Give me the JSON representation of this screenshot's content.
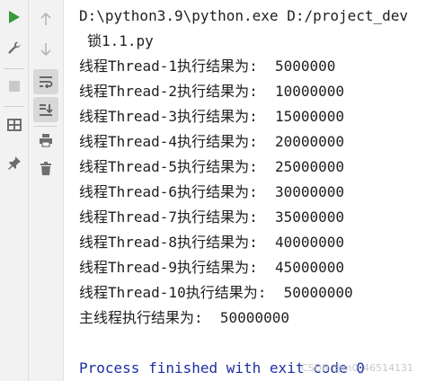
{
  "command_line": "D:\\python3.9\\python.exe D:/project_dev",
  "script_name": "锁1.1.py",
  "output_lines": [
    "线程Thread-1执行结果为:  5000000",
    "线程Thread-2执行结果为:  10000000",
    "线程Thread-3执行结果为:  15000000",
    "线程Thread-4执行结果为:  20000000",
    "线程Thread-5执行结果为:  25000000",
    "线程Thread-6执行结果为:  30000000",
    "线程Thread-7执行结果为:  35000000",
    "线程Thread-8执行结果为:  40000000",
    "线程Thread-9执行结果为:  45000000",
    "线程Thread-10执行结果为:  50000000",
    "主线程执行结果为:  50000000"
  ],
  "finished_line": "Process finished with exit code 0",
  "watermark": "CSDN @m0_46514131",
  "colors": {
    "run_green": "#3b9a3b",
    "finished_blue": "#1c2fa0",
    "toolbar_bg": "#f2f2f2"
  },
  "icons": {
    "rerun": "run-icon",
    "wrench": "settings-wrench-icon",
    "stop": "stop-icon",
    "layout": "layout-icon",
    "pin": "pin-icon",
    "up": "up-arrow-icon",
    "down": "down-arrow-icon",
    "soft_wrap": "soft-wrap-icon",
    "scroll_end": "scroll-to-end-icon",
    "print": "print-icon",
    "delete": "trash-icon"
  }
}
